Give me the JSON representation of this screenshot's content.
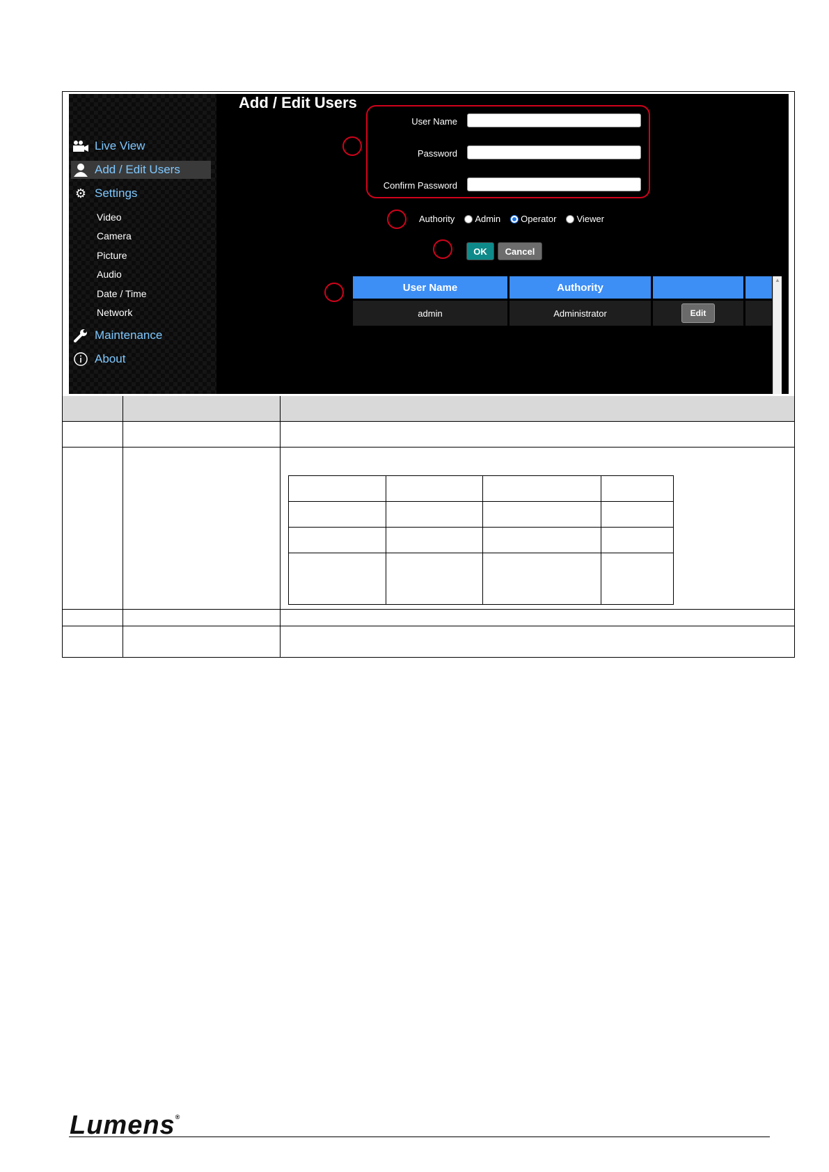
{
  "screen": {
    "title": "Add / Edit Users",
    "nav": {
      "live_view": "Live View",
      "add_edit_users": "Add / Edit Users",
      "settings": "Settings",
      "settings_items": [
        "Video",
        "Camera",
        "Picture",
        "Audio",
        "Date / Time",
        "Network"
      ],
      "maintenance": "Maintenance",
      "about": "About"
    },
    "form": {
      "user_name_label": "User Name",
      "password_label": "Password",
      "confirm_password_label": "Confirm Password",
      "user_name_value": "",
      "password_value": "",
      "confirm_password_value": ""
    },
    "authority": {
      "label": "Authority",
      "options": [
        "Admin",
        "Operator",
        "Viewer"
      ],
      "selected": "Operator"
    },
    "buttons": {
      "ok": "OK",
      "cancel": "Cancel"
    },
    "users_table": {
      "headers": [
        "User Name",
        "Authority",
        "",
        ""
      ],
      "rows": [
        {
          "user_name": "admin",
          "authority": "Administrator",
          "action": "Edit"
        }
      ]
    },
    "colors": {
      "annotation_red": "#d0021b",
      "header_blue": "#3d8ef5",
      "ok_teal": "#0f8a8a",
      "nav_blue": "#7fc8ff"
    }
  },
  "footer": {
    "logo": "Lumens",
    "registered": "®"
  }
}
